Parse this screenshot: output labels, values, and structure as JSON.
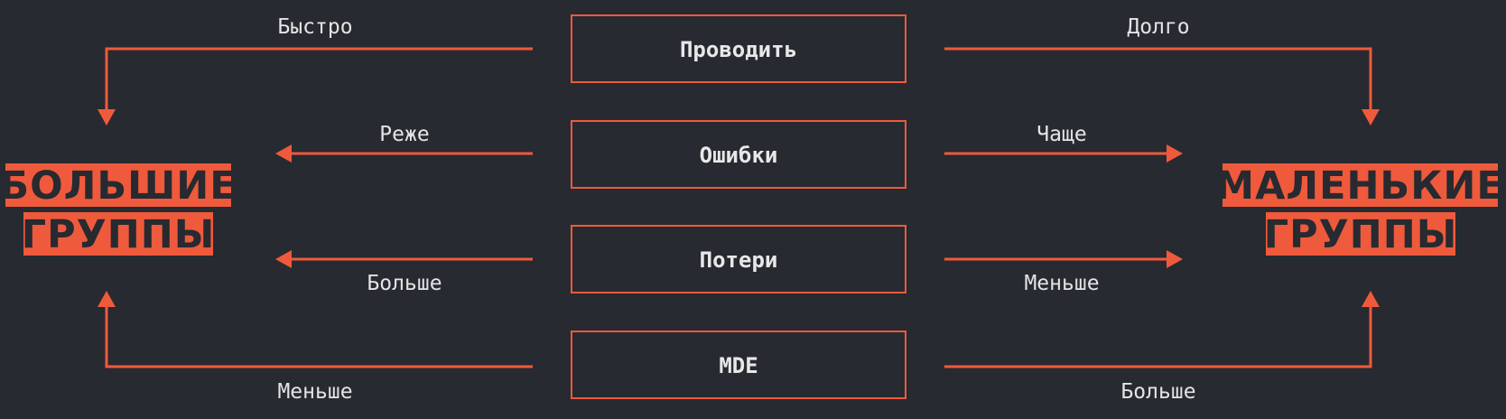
{
  "left_group": {
    "line1": "БОЛЬШИЕ",
    "line2": "ГРУППЫ"
  },
  "right_group": {
    "line1": "МАЛЕНЬКИЕ",
    "line2": "ГРУППЫ"
  },
  "factors": [
    {
      "label": "Проводить",
      "left": "Быстро",
      "right": "Долго"
    },
    {
      "label": "Ошибки",
      "left": "Реже",
      "right": "Чаще"
    },
    {
      "label": "Потери",
      "left": "Больше",
      "right": "Меньше"
    },
    {
      "label": "MDE",
      "left": "Меньше",
      "right": "Больше"
    }
  ],
  "colors": {
    "background": "#272a30",
    "accent": "#ef5a3c",
    "text": "#e4e4e4"
  }
}
